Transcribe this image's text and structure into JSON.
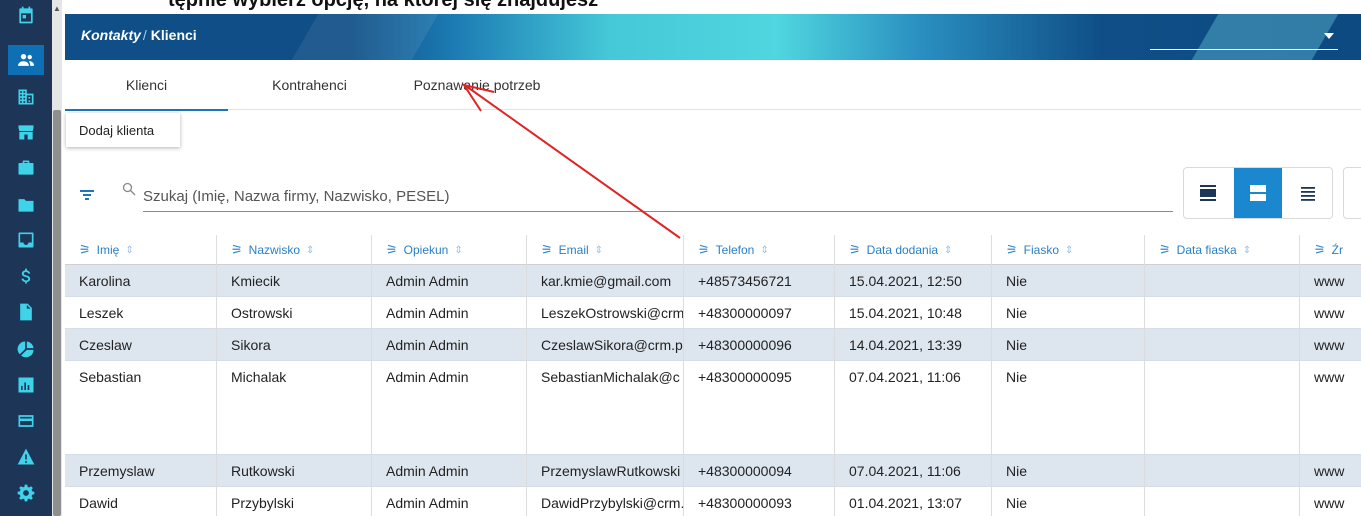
{
  "top_strip": {
    "text": "tępnie wybierz opcję, na której się znajdujesz"
  },
  "header": {
    "crumb": "Kontakty",
    "separator": "/",
    "current": "Klienci"
  },
  "tabs": [
    {
      "label": "Klienci",
      "active": true
    },
    {
      "label": "Kontrahenci",
      "active": false
    },
    {
      "label": "Poznawanie potrzeb",
      "active": false
    }
  ],
  "toolbar": {
    "add_client_label": "Dodaj klienta"
  },
  "search": {
    "placeholder": "Szukaj (Imię, Nazwa firmy, Nazwisko, PESEL)"
  },
  "view_modes": [
    "view-large-icon",
    "view-medium-icon",
    "view-list-icon"
  ],
  "sidebar_icons": [
    "calendar-icon",
    "contacts-icon",
    "building-icon",
    "store-icon",
    "briefcase-icon",
    "folder-icon",
    "inbox-icon",
    "dollar-icon",
    "document-icon",
    "pie-chart-icon",
    "bar-chart-icon",
    "card-icon",
    "warning-icon",
    "gear-icon"
  ],
  "table": {
    "columns": [
      "Imię",
      "Nazwisko",
      "Opiekun",
      "Email",
      "Telefon",
      "Data dodania",
      "Fiasko",
      "Data fiaska",
      "Źr"
    ],
    "rows": [
      [
        "Karolina",
        "Kmiecik",
        "Admin Admin",
        "kar.kmie@gmail.com",
        "+48573456721",
        "15.04.2021, 12:50",
        "Nie",
        "",
        "www"
      ],
      [
        "Leszek",
        "Ostrowski",
        "Admin Admin",
        "LeszekOstrowski@crm",
        "+48300000097",
        "15.04.2021, 10:48",
        "Nie",
        "",
        "www"
      ],
      [
        "Czeslaw",
        "Sikora",
        "Admin Admin",
        "CzeslawSikora@crm.p",
        "+48300000096",
        "14.04.2021, 13:39",
        "Nie",
        "",
        "www"
      ],
      [
        "Sebastian",
        "Michalak",
        "Admin Admin",
        "SebastianMichalak@c",
        "+48300000095",
        "07.04.2021, 11:06",
        "Nie",
        "",
        "www"
      ],
      [
        "Przemyslaw",
        "Rutkowski",
        "Admin Admin",
        "PrzemyslawRutkowski",
        "+48300000094",
        "07.04.2021, 11:06",
        "Nie",
        "",
        "www"
      ],
      [
        "Dawid",
        "Przybylski",
        "Admin Admin",
        "DawidPrzybylski@crm.",
        "+48300000093",
        "01.04.2021, 13:07",
        "Nie",
        "",
        "www"
      ]
    ]
  },
  "colors": {
    "sidebar": "#1d3557",
    "accent": "#1e73be",
    "icon": "#3fd3ea",
    "row_alt": "#dde6ef",
    "annotation": "#e02424"
  }
}
